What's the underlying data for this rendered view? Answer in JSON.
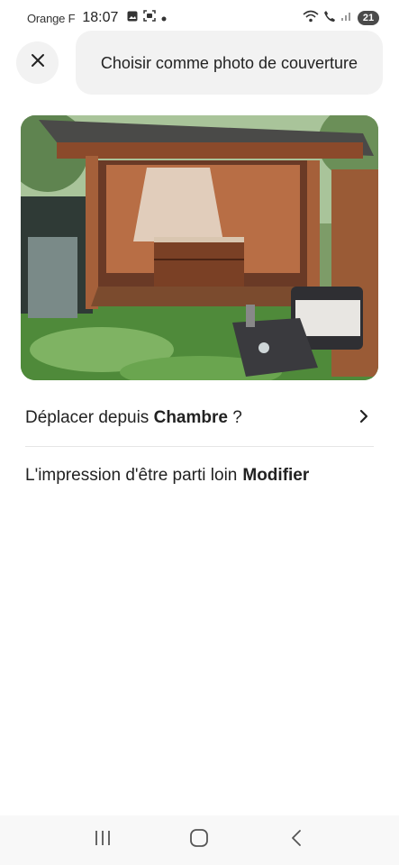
{
  "status_bar": {
    "carrier": "Orange F",
    "time": "18:07",
    "battery": "21",
    "icons_left": [
      "gallery-icon",
      "screenshot-icon",
      "dot-icon"
    ],
    "icons_right": [
      "wifi-icon",
      "call-icon",
      "signal-icon",
      "battery-icon"
    ]
  },
  "header": {
    "close_icon": "close-icon",
    "title": "Choisir comme photo de couverture"
  },
  "photo": {
    "description_icon": "photo-image"
  },
  "move_row": {
    "prefix": "Déplacer depuis ",
    "room": "Chambre",
    "suffix": " ?",
    "icon": "chevron-right-icon"
  },
  "caption_row": {
    "caption": "L'impression d'être parti loin",
    "action": "Modifier"
  },
  "nav_bar": {
    "items": [
      "recent-apps-icon",
      "home-icon",
      "back-icon"
    ]
  },
  "colors": {
    "text": "#222222",
    "pill_bg": "#f2f2f2",
    "divider": "#e6e6e6",
    "nav_bg": "#f8f8f8"
  }
}
